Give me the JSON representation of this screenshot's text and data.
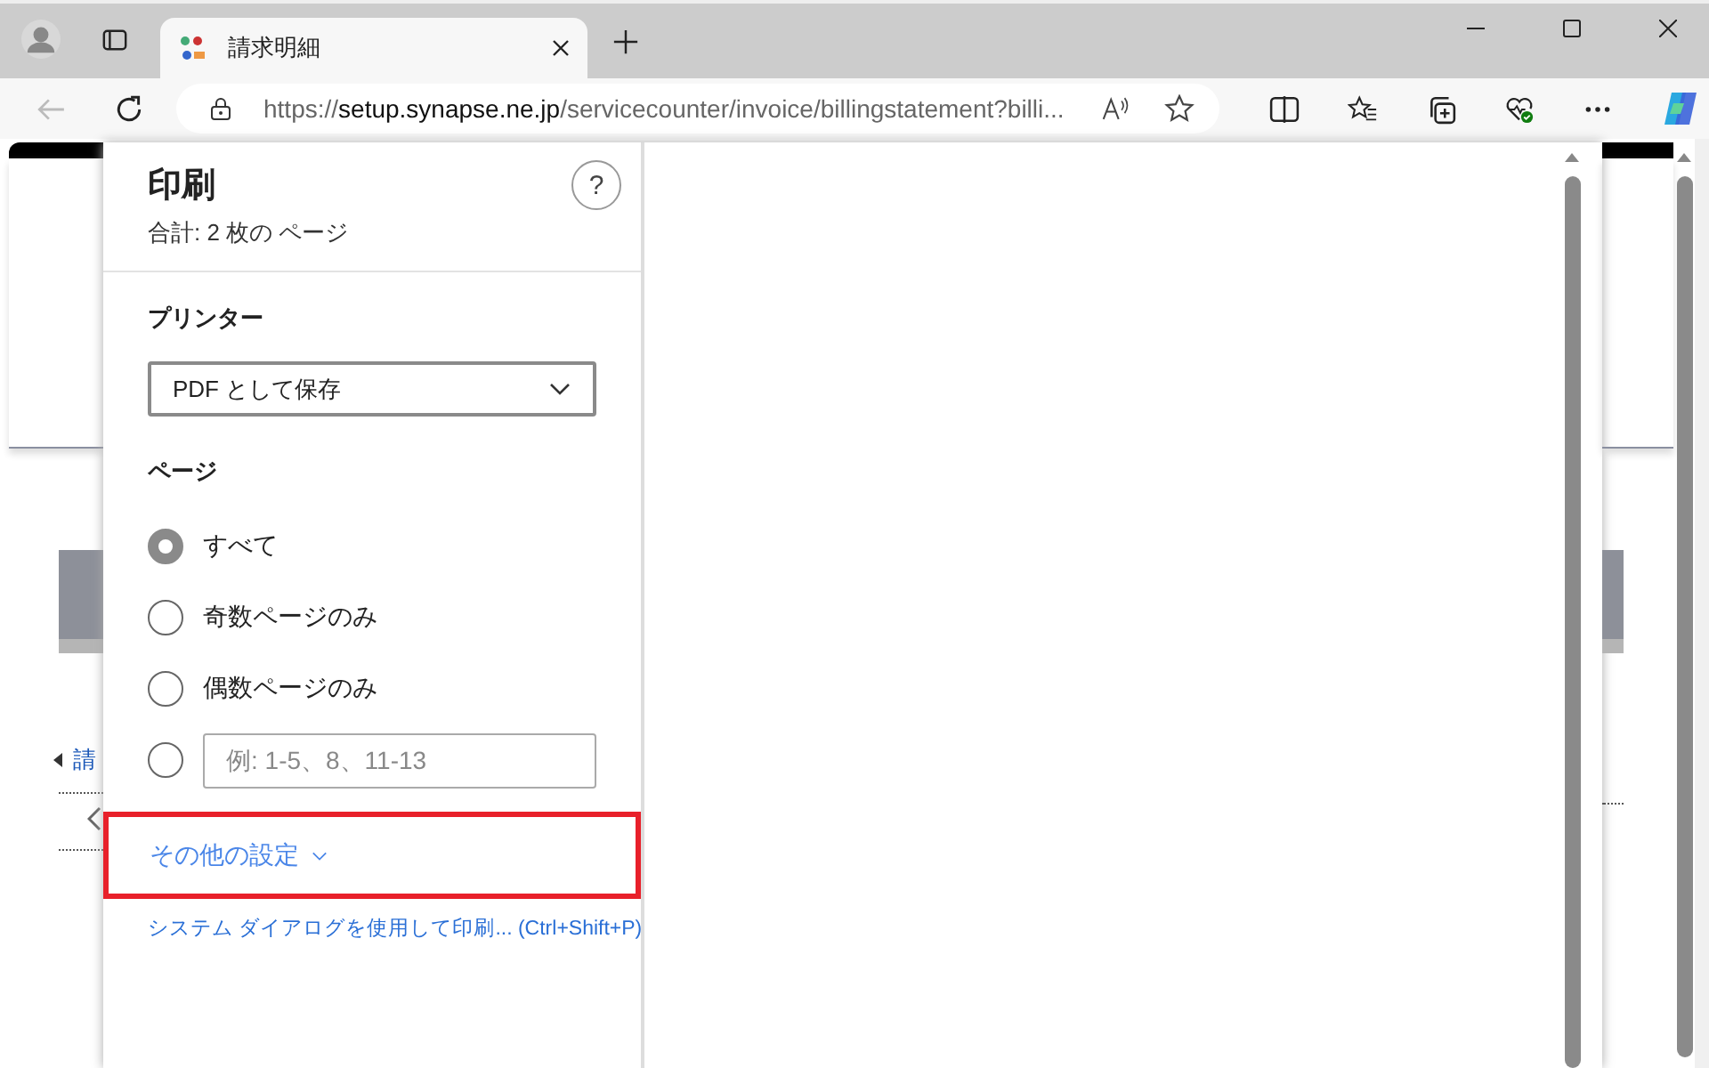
{
  "browser": {
    "tab": {
      "title": "請求明細",
      "selected": true
    },
    "address": {
      "scheme": "https://",
      "host": "setup.synapse.ne.jp",
      "path": "/servicecounter/invoice/billingstatement?billi..."
    },
    "back_disabled": true
  },
  "background_page": {
    "link": "請"
  },
  "print_dialog": {
    "title": "印刷",
    "subtitle": "合計: 2 枚の ページ",
    "help": "?",
    "printer_label": "プリンター",
    "printer": "PDF として保存",
    "pages_label": "ページ",
    "page_options": [
      {
        "kind": "radio",
        "label": "すべて",
        "selected": true
      },
      {
        "kind": "radio",
        "label": "奇数ページのみ",
        "selected": false
      },
      {
        "kind": "radio",
        "label": "偶数ページのみ",
        "selected": false
      },
      {
        "kind": "custom",
        "placeholder": "例: 1-5、8、11-13",
        "selected": false
      }
    ],
    "more_settings": {
      "label": "その他の設定",
      "expanded": false,
      "highlighted": true
    },
    "system_dialog_link": "システム ダイアログを使用して印刷... (Ctrl+Shift+P)"
  }
}
